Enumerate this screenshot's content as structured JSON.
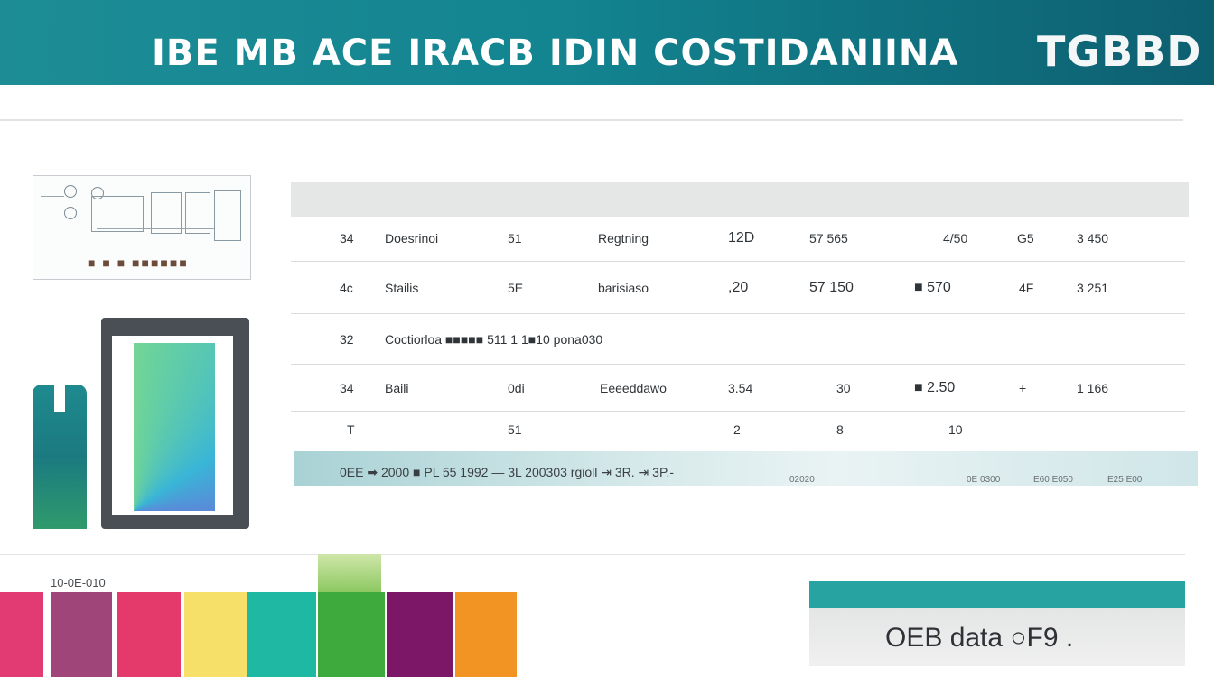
{
  "header": {
    "title": "IBE MB ACE IRACB IDIN COSTIDANIINA",
    "badge": "TGBBD"
  },
  "thumbnail": {
    "caption": "■ ■ ■ ■■■■■■"
  },
  "table": {
    "rows": [
      [
        "34",
        "Doesrinoi",
        "51",
        "Regtning",
        "12D",
        "57 565",
        "4/50",
        "G5",
        "3 450"
      ],
      [
        "4c",
        "Stailis",
        "5E",
        "barisiaso",
        ",20",
        "57 150",
        "■ 570",
        "4F",
        "3 251"
      ],
      [
        "32",
        "Coctiorloa ■■■■■ 511 1 1■10 pona030",
        "",
        "",
        "",
        "",
        "",
        "",
        ""
      ],
      [
        "34",
        "Baili",
        "0di",
        "Eeeeddawo",
        "3.54",
        "30",
        "■ 2.50",
        "+",
        "1 166"
      ],
      [
        "T",
        "",
        "51",
        "",
        "2",
        "8",
        "10",
        "",
        ""
      ]
    ],
    "footer": "0ЕЕ ➡ 2000 ■ PL 55 1992 — 3L 200303 rgioll ⇥ 3R. ⇥ 3P.-",
    "footer_cells": [
      "02020",
      "0E 0300",
      "E60 E050",
      "E25 E00"
    ]
  },
  "swatches": {
    "label": "10-0E-010",
    "colors": [
      "#e23b73",
      "#a0457a",
      "#e33a6b",
      "#f6e06a",
      "#1fb8a2",
      "#3eaa3e",
      "#7c1768",
      "#f29424"
    ]
  },
  "panel": {
    "text": "OEB data ○F9 ."
  }
}
